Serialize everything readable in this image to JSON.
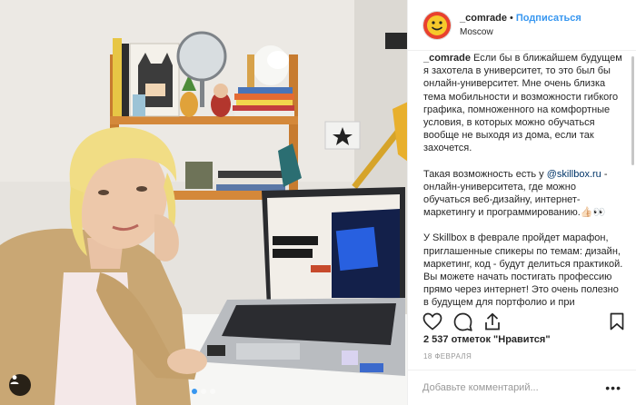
{
  "post": {
    "photo_alt": "Girl with laptop at desk",
    "carousel": {
      "count": 3,
      "active": 1
    }
  },
  "header": {
    "username": "_comrade",
    "separator": "•",
    "follow_label": "Подписаться",
    "location": "Moscow"
  },
  "caption": {
    "author": "_comrade",
    "para1": "Если бы в ближайшем будущем я захотела в университет, то это был бы онлайн-университет. Мне очень близка тема мобильности и возможности гибкого графика, помноженного на комфортные условия, в которых можно обучаться вообще не выходя из дома, если так захочется.",
    "para2_pre": "Такая возможность есть у ",
    "para2_mention": "@skillbox.ru",
    "para2_post": " - онлайн-университета, где можно обучаться веб-дизайну, интернет-маркетингу и программированию.👍🏻👀",
    "para3": "У Skillbox в феврале пройдет марафон, приглашенные спикеры по темам: дизайн, маркетинг, код - будут делиться практикой. Вы можете начать постигать профессию прямо через интернет! Это очень полезно в будущем для портфолио и при трудоустройстве."
  },
  "likes": {
    "text": "2 537 отметок \"Нравится\""
  },
  "date": {
    "text": "18 ФЕВРАЛЯ"
  },
  "comment": {
    "placeholder": "Добавьте комментарий...",
    "more": "•••"
  },
  "colors": {
    "accent": "#3897f0",
    "text": "#262626",
    "muted": "#999999",
    "border": "#efefef"
  },
  "icons": [
    "heart-icon",
    "comment-icon",
    "share-icon",
    "bookmark-icon",
    "user-tag-icon"
  ]
}
